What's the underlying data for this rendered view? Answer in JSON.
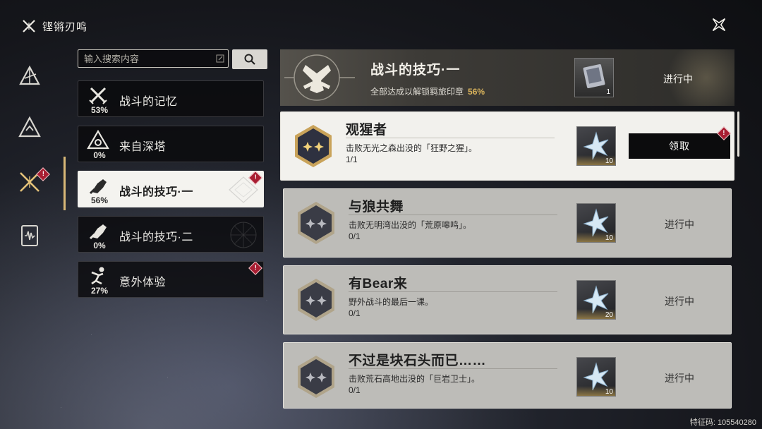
{
  "header": {
    "title": "铿锵刃鸣"
  },
  "search": {
    "placeholder": "输入搜索内容"
  },
  "categories": [
    {
      "label": "战斗的记忆",
      "percent": "53%",
      "icon": "crossed-swords-icon",
      "badge": false
    },
    {
      "label": "来自深塔",
      "percent": "0%",
      "icon": "tower-sigil-icon",
      "badge": false
    },
    {
      "label": "战斗的技巧·一",
      "percent": "56%",
      "icon": "fist-icon",
      "badge": true,
      "active": true
    },
    {
      "label": "战斗的技巧·二",
      "percent": "0%",
      "icon": "fist-icon",
      "badge": false
    },
    {
      "label": "意外体验",
      "percent": "27%",
      "icon": "falling-figure-icon",
      "badge": true
    }
  ],
  "banner": {
    "title": "战斗的技巧·一",
    "subtitle": "全部达成以解锁羁旅印章",
    "percent": "56%",
    "reward_qty": "1",
    "status": "进行中"
  },
  "badge_mark": "!",
  "tasks": [
    {
      "title": "观猩者",
      "desc": "击败无光之森出没的「狂野之猩」。",
      "progress": "1/1",
      "reward_qty": "10",
      "status": "领取",
      "claimable": true
    },
    {
      "title": "与狼共舞",
      "desc": "击败无明湾出没的「荒原嗥鸣」。",
      "progress": "0/1",
      "reward_qty": "10",
      "status": "进行中",
      "claimable": false
    },
    {
      "title": "有Bear来",
      "desc": "野外战斗的最后一课。",
      "progress": "0/1",
      "reward_qty": "20",
      "status": "进行中",
      "claimable": false
    },
    {
      "title": "不过是块石头而已……",
      "desc": "击败荒石高地出没的「巨岩卫士」。",
      "progress": "0/1",
      "reward_qty": "10",
      "status": "进行中",
      "claimable": false
    }
  ],
  "footer": {
    "feature_code": "特征码: 105540280"
  }
}
